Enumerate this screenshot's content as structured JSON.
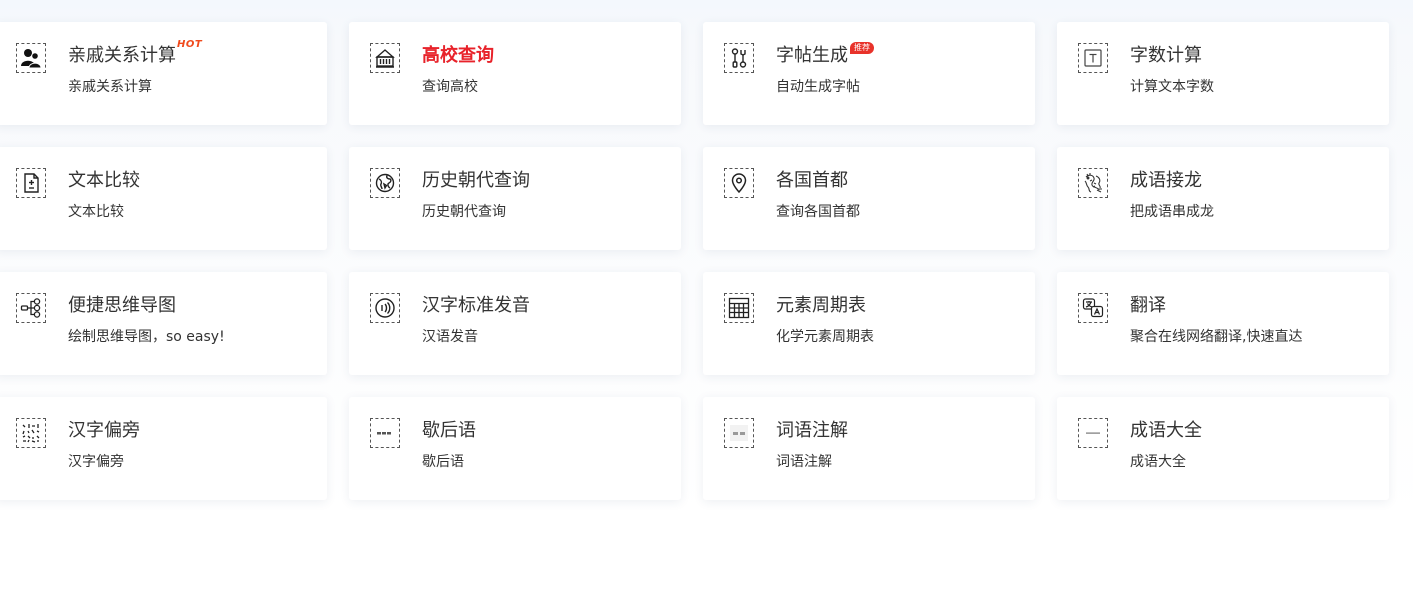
{
  "tools": [
    {
      "id": "relatives",
      "icon": "relatives-icon",
      "title": "亲戚关系计算",
      "desc": "亲戚关系计算",
      "badge": "HOT"
    },
    {
      "id": "university",
      "icon": "university-icon",
      "title": "高校查询",
      "desc": "查询高校",
      "highlight": true
    },
    {
      "id": "copybook",
      "icon": "tools-icon",
      "title": "字帖生成",
      "desc": "自动生成字帖",
      "badge_rec": "推荐"
    },
    {
      "id": "word-count",
      "icon": "text-box-icon",
      "title": "字数计算",
      "desc": "计算文本字数"
    },
    {
      "id": "text-compare",
      "icon": "document-compare-icon",
      "title": "文本比较",
      "desc": "文本比较"
    },
    {
      "id": "dynasty",
      "icon": "globe-icon",
      "title": "历史朝代查询",
      "desc": "历史朝代查询"
    },
    {
      "id": "capitals",
      "icon": "map-pin-icon",
      "title": "各国首都",
      "desc": "查询各国首都"
    },
    {
      "id": "idiom-chain",
      "icon": "dragon-icon",
      "title": "成语接龙",
      "desc": "把成语串成龙"
    },
    {
      "id": "mindmap",
      "icon": "mindmap-icon",
      "title": "便捷思维导图",
      "desc": "绘制思维导图，so easy!"
    },
    {
      "id": "pronunciation",
      "icon": "sound-wave-icon",
      "title": "汉字标准发音",
      "desc": "汉语发音"
    },
    {
      "id": "periodic-table",
      "icon": "table-grid-icon",
      "title": "元素周期表",
      "desc": "化学元素周期表"
    },
    {
      "id": "translate",
      "icon": "translate-icon",
      "title": "翻译",
      "desc": "聚合在线网络翻译,快速直达"
    },
    {
      "id": "radicals",
      "icon": "radicals-icon",
      "title": "汉字偏旁",
      "desc": "汉字偏旁"
    },
    {
      "id": "xiehouyu",
      "icon": "xiehouyu-thumbnail-icon",
      "title": "歇后语",
      "desc": "歇后语"
    },
    {
      "id": "word-notes",
      "icon": "word-notes-thumbnail-icon",
      "title": "词语注解",
      "desc": "词语注解"
    },
    {
      "id": "idioms",
      "icon": "idioms-thumbnail-icon",
      "title": "成语大全",
      "desc": "成语大全"
    }
  ]
}
